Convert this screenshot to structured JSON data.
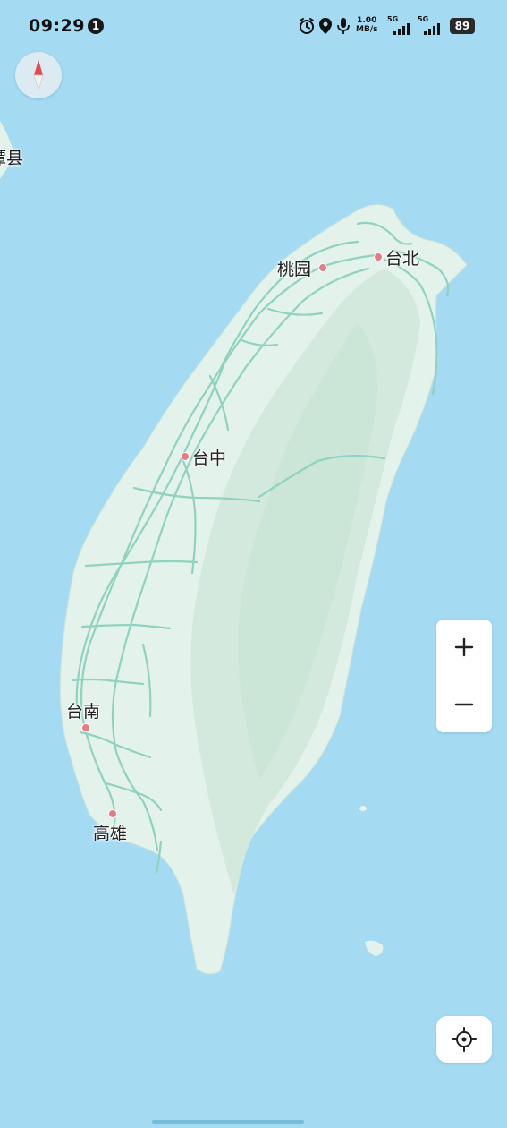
{
  "status_bar": {
    "time": "09:29",
    "notification_count": "1",
    "net_speed_value": "1.00",
    "net_speed_unit": "MB/s",
    "sim1_tag": "5G",
    "sim2_tag": "5G",
    "battery": "89"
  },
  "map": {
    "offmap_label": "潭县",
    "cities": [
      {
        "name": "桃园"
      },
      {
        "name": "台北"
      },
      {
        "name": "台中"
      },
      {
        "name": "台南"
      },
      {
        "name": "高雄"
      }
    ],
    "colors": {
      "water": "#a4dbf3",
      "land": "#e3f2ea",
      "mountain": "#cfe6d9",
      "road": "#8fd2bf",
      "city_dot": "#e47c84"
    }
  },
  "controls": {
    "compass": "compass-icon",
    "zoom_in": "plus-icon",
    "zoom_out": "minus-icon",
    "locate": "locate-icon"
  }
}
